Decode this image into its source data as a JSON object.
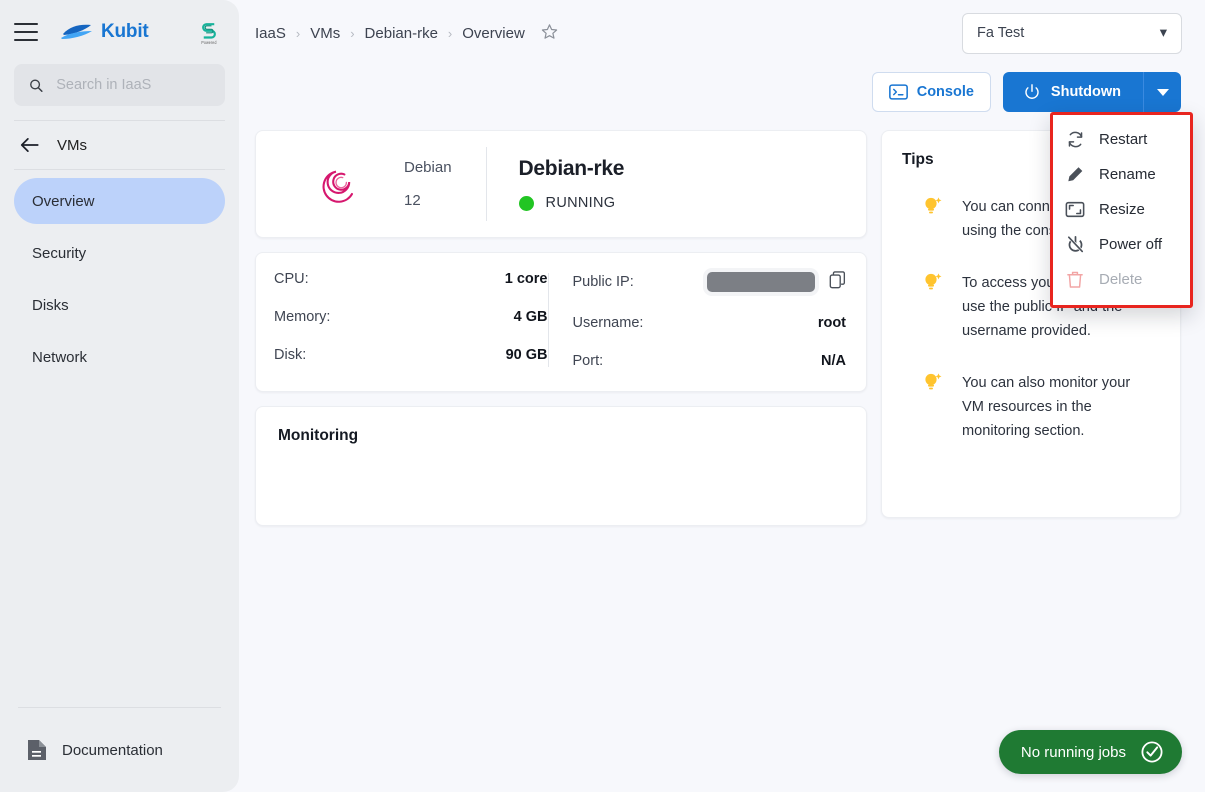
{
  "sidebar": {
    "brand_name": "Kubit",
    "partner_logo_caption": "Powered",
    "search_placeholder": "Search in IaaS",
    "search_value": "",
    "back_label": "VMs",
    "items": [
      {
        "label": "Overview",
        "active": true
      },
      {
        "label": "Security",
        "active": false
      },
      {
        "label": "Disks",
        "active": false
      },
      {
        "label": "Network",
        "active": false
      }
    ],
    "documentation_label": "Documentation"
  },
  "topbar": {
    "breadcrumbs": [
      "IaaS",
      "VMs",
      "Debian-rke",
      "Overview"
    ],
    "separator": "›",
    "tenant_selector": {
      "value": "Fa Test",
      "caret": "▾"
    }
  },
  "actions": {
    "console_label": "Console",
    "shutdown_label": "Shutdown",
    "caret": "▾"
  },
  "dropdown_menu": {
    "border_color": "#e8251f",
    "items": [
      {
        "label": "Restart",
        "icon": "restart-icon",
        "disabled": false
      },
      {
        "label": "Rename",
        "icon": "pencil-icon",
        "disabled": false
      },
      {
        "label": "Resize",
        "icon": "resize-icon",
        "disabled": false
      },
      {
        "label": "Power off",
        "icon": "power-off-icon",
        "disabled": false
      },
      {
        "label": "Delete",
        "icon": "trash-icon",
        "disabled": true
      }
    ]
  },
  "vm": {
    "distro_name": "Debian",
    "distro_version": "12",
    "name": "Debian-rke",
    "status": "RUNNING",
    "status_color": "#22c523",
    "specs_left": [
      {
        "key": "CPU:",
        "value": "1 core"
      },
      {
        "key": "Memory:",
        "value": "4 GB"
      },
      {
        "key": "Disk:",
        "value": "90 GB"
      }
    ],
    "specs_right": [
      {
        "key": "Public IP:",
        "value": "",
        "masked": true
      },
      {
        "key": "Username:",
        "value": "root",
        "masked": false
      },
      {
        "key": "Port:",
        "value": "N/A",
        "masked": false
      }
    ]
  },
  "monitoring": {
    "title": "Monitoring"
  },
  "tips": {
    "title": "Tips",
    "items": [
      "You can connect to your VM using the console button.",
      "To access your VM via SSH, use the public IP and the username provided.",
      "You can also monitor your VM resources in the monitoring section."
    ]
  },
  "jobs_badge": {
    "label": "No running jobs",
    "color": "#1f7a33"
  }
}
